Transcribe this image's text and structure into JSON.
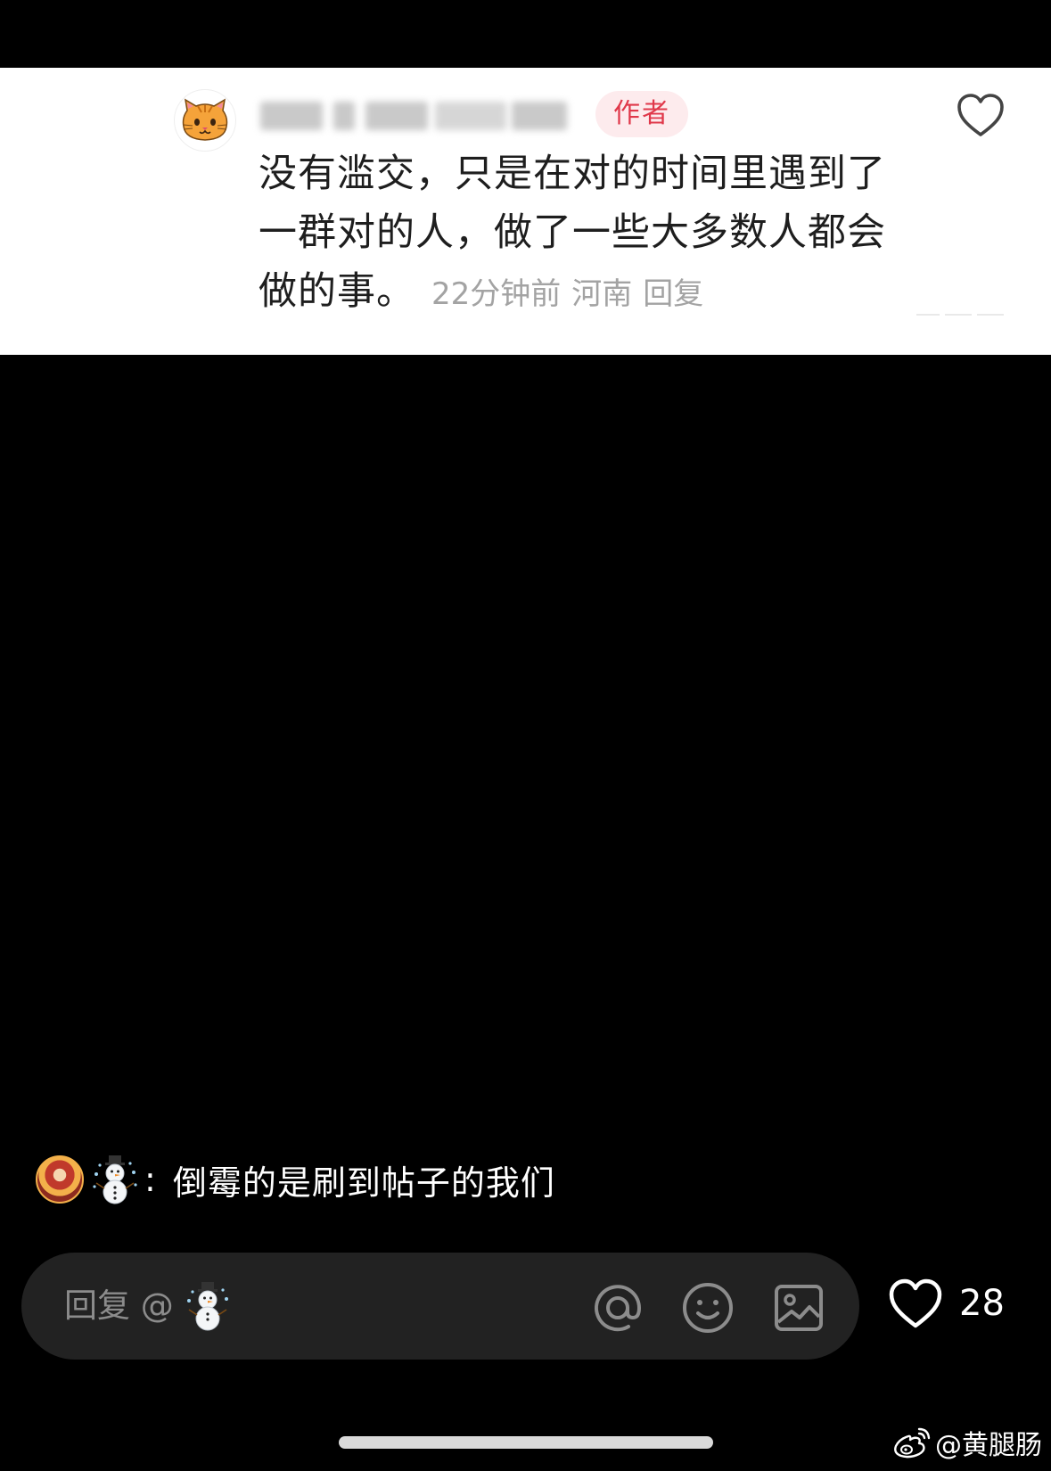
{
  "comment_card": {
    "username": "",
    "author_badge": "作者",
    "text": "没有滥交，只是在对的时间里遇到了一群对的人，做了一些大多数人都会做的事。",
    "time": "22分钟前",
    "location": "河南",
    "reply_label": "回复"
  },
  "danmaku": {
    "separator": ":",
    "text": "倒霉的是刷到帖子的我们"
  },
  "reply_bar": {
    "placeholder": "回复 @"
  },
  "like": {
    "count": "28"
  },
  "watermark": {
    "text": "@黄腿肠"
  },
  "icons": {
    "card_avatar": "cat-face-icon",
    "card_like": "heart-outline-icon",
    "commenter_emoji": "snowman-icon",
    "mention": "at-sign-icon",
    "emoji": "smiley-icon",
    "image": "image-icon",
    "like": "heart-outline-icon",
    "weibo": "weibo-logo-icon"
  },
  "colors": {
    "author_badge_bg": "#fdebed",
    "author_badge_text": "#e0384a",
    "reply_bar_bg": "#222222",
    "meta_text": "#a3a3a3"
  }
}
